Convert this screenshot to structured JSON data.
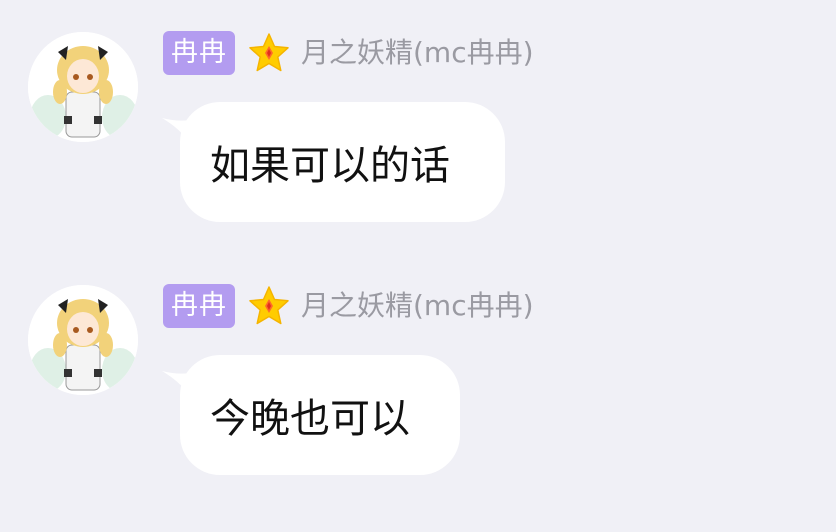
{
  "messages": [
    {
      "sender_title": "冉冉",
      "sender_name": "月之妖精(mc冉冉)",
      "text": "如果可以的话",
      "level_icon": "star-icon",
      "avatar_icon": "anime-girl-avatar"
    },
    {
      "sender_title": "冉冉",
      "sender_name": "月之妖精(mc冉冉)",
      "text": "今晚也可以",
      "level_icon": "star-icon",
      "avatar_icon": "anime-girl-avatar"
    }
  ],
  "colors": {
    "background": "#f0f0f6",
    "title_badge": "#b39cf0",
    "bubble": "#ffffff",
    "nickname": "#9a9aa2",
    "star": "#ffcc00"
  }
}
